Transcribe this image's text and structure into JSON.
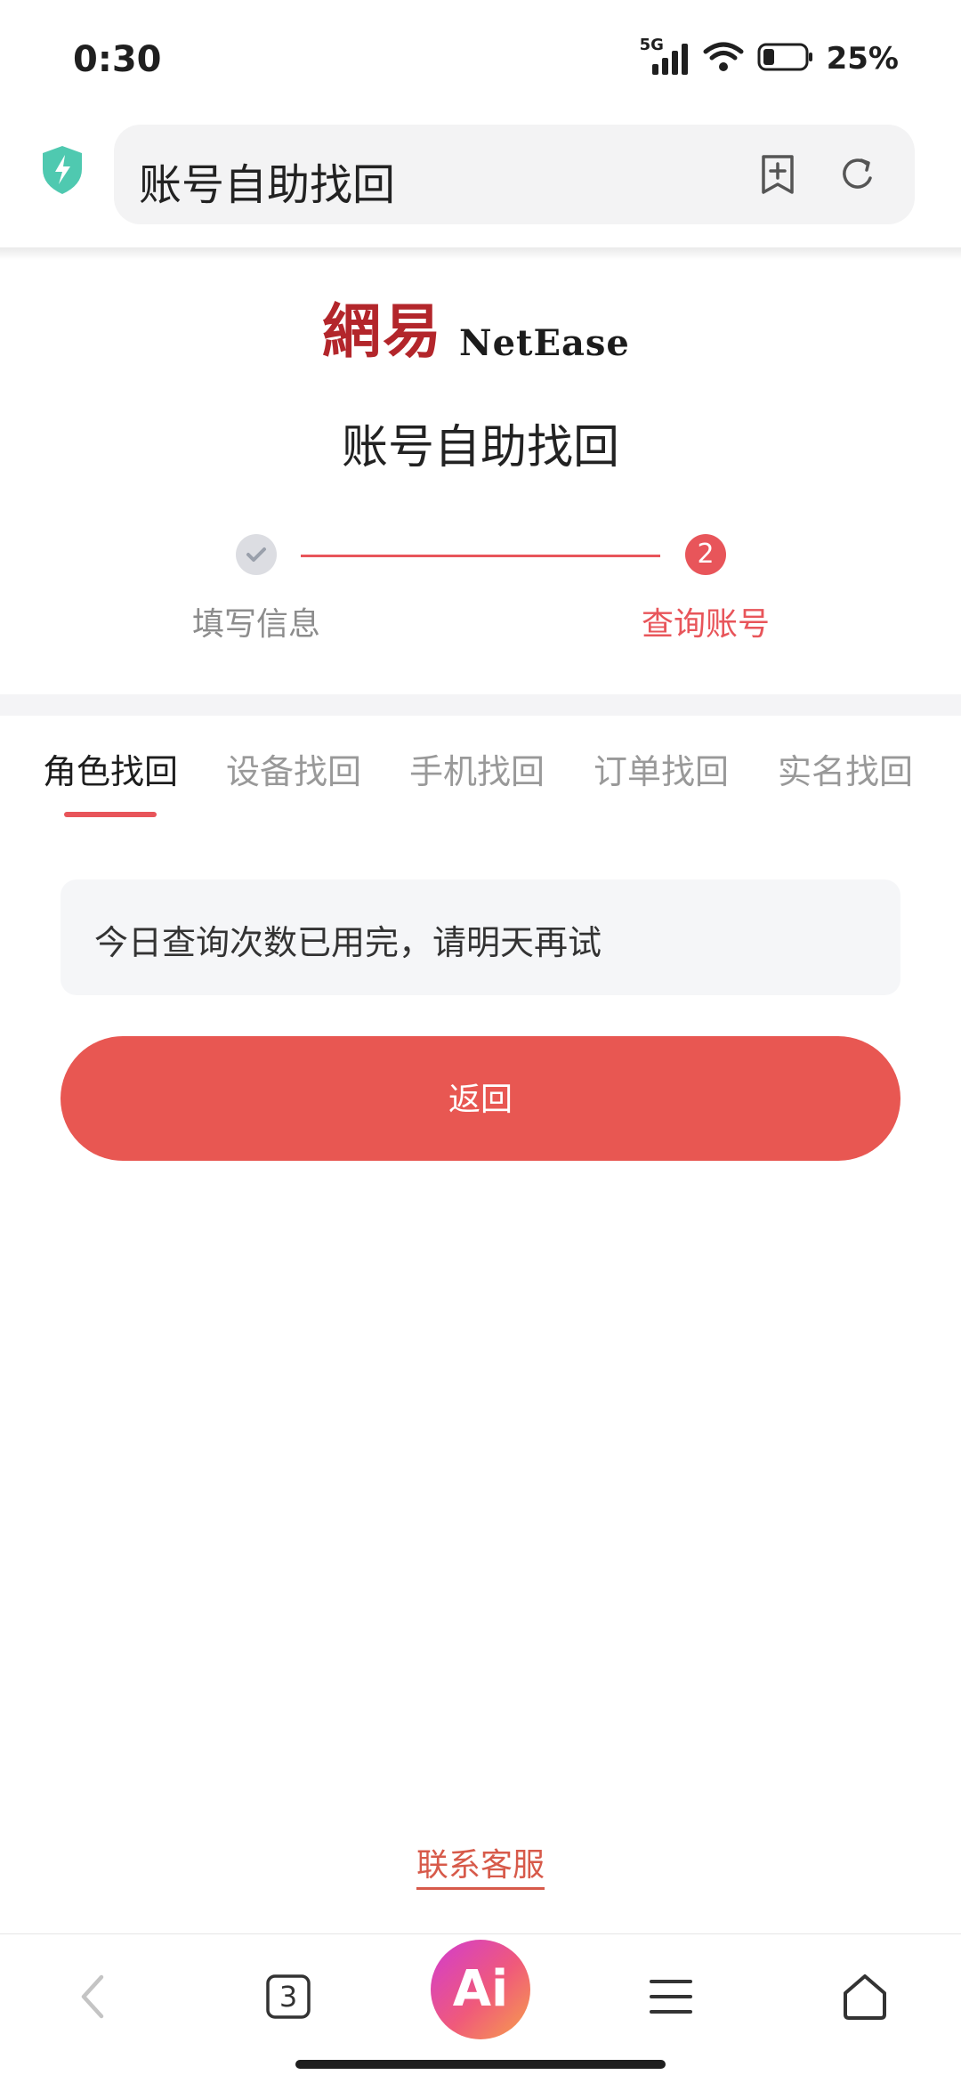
{
  "status_bar": {
    "time": "0:30",
    "network": "5G",
    "battery": "25%"
  },
  "browser": {
    "url_title": "账号自助找回",
    "tab_count": "3",
    "ai_label": "Ai"
  },
  "logo": {
    "cn": "網易",
    "en": "NetEase"
  },
  "page": {
    "title": "账号自助找回"
  },
  "steps": [
    {
      "label": "填写信息",
      "state": "done"
    },
    {
      "label": "查询账号",
      "number": "2",
      "state": "active"
    }
  ],
  "tabs": [
    {
      "label": "角色找回",
      "active": true
    },
    {
      "label": "设备找回"
    },
    {
      "label": "手机找回"
    },
    {
      "label": "订单找回"
    },
    {
      "label": "实名找回"
    }
  ],
  "notice": {
    "text": "今日查询次数已用完，请明天再试"
  },
  "back_button": {
    "label": "返回"
  },
  "contact": {
    "label": "联系客服"
  },
  "colors": {
    "accent": "#e8555a",
    "logo_red": "#b3262b",
    "shield": "#4fc9b0"
  }
}
